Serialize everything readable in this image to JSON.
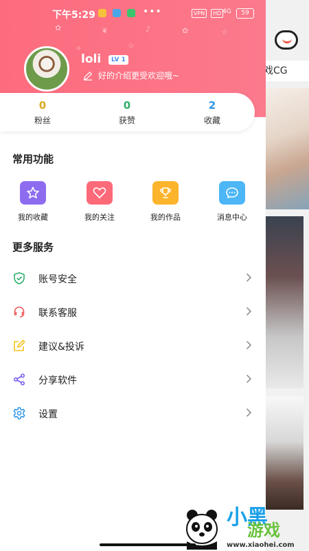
{
  "status_bar": {
    "time": "下午5:29",
    "dots": "•••",
    "vpn": "VPN",
    "hd1": "HD",
    "signal1": "4G",
    "hd2": "HD",
    "signal2": "4G",
    "battery": "59"
  },
  "profile": {
    "username": "loli",
    "level": "LV 1",
    "bio": "好的介绍更受欢迎哦~"
  },
  "stats": [
    {
      "value": "0",
      "label": "粉丝",
      "color": "#d9a81f"
    },
    {
      "value": "0",
      "label": "获赞",
      "color": "#2eae6b"
    },
    {
      "value": "2",
      "label": "收藏",
      "color": "#2e95e6"
    }
  ],
  "common_functions": {
    "title": "常用功能",
    "items": [
      {
        "label": "我的收藏",
        "icon": "star-icon",
        "color": "#8d6cf0"
      },
      {
        "label": "我的关注",
        "icon": "heart-icon",
        "color": "#fc6a7a"
      },
      {
        "label": "我的作品",
        "icon": "trophy-icon",
        "color": "#fcb42c"
      },
      {
        "label": "消息中心",
        "icon": "chat-icon",
        "color": "#4cb6f7"
      }
    ]
  },
  "more_services": {
    "title": "更多服务",
    "items": [
      {
        "label": "账号安全",
        "icon": "shield-icon",
        "color": "#2eae6b"
      },
      {
        "label": "联系客服",
        "icon": "headset-icon",
        "color": "#f05a5a"
      },
      {
        "label": "建议&投诉",
        "icon": "edit-icon",
        "color": "#f3c21b"
      },
      {
        "label": "分享软件",
        "icon": "share-icon",
        "color": "#7a5cf0"
      },
      {
        "label": "设置",
        "icon": "gear-icon",
        "color": "#2e95e6"
      }
    ]
  },
  "background": {
    "tab_label": "戏CG"
  },
  "watermark": {
    "text1": "小黑",
    "text2": "游戏",
    "url": "www.xiaohei.com"
  }
}
